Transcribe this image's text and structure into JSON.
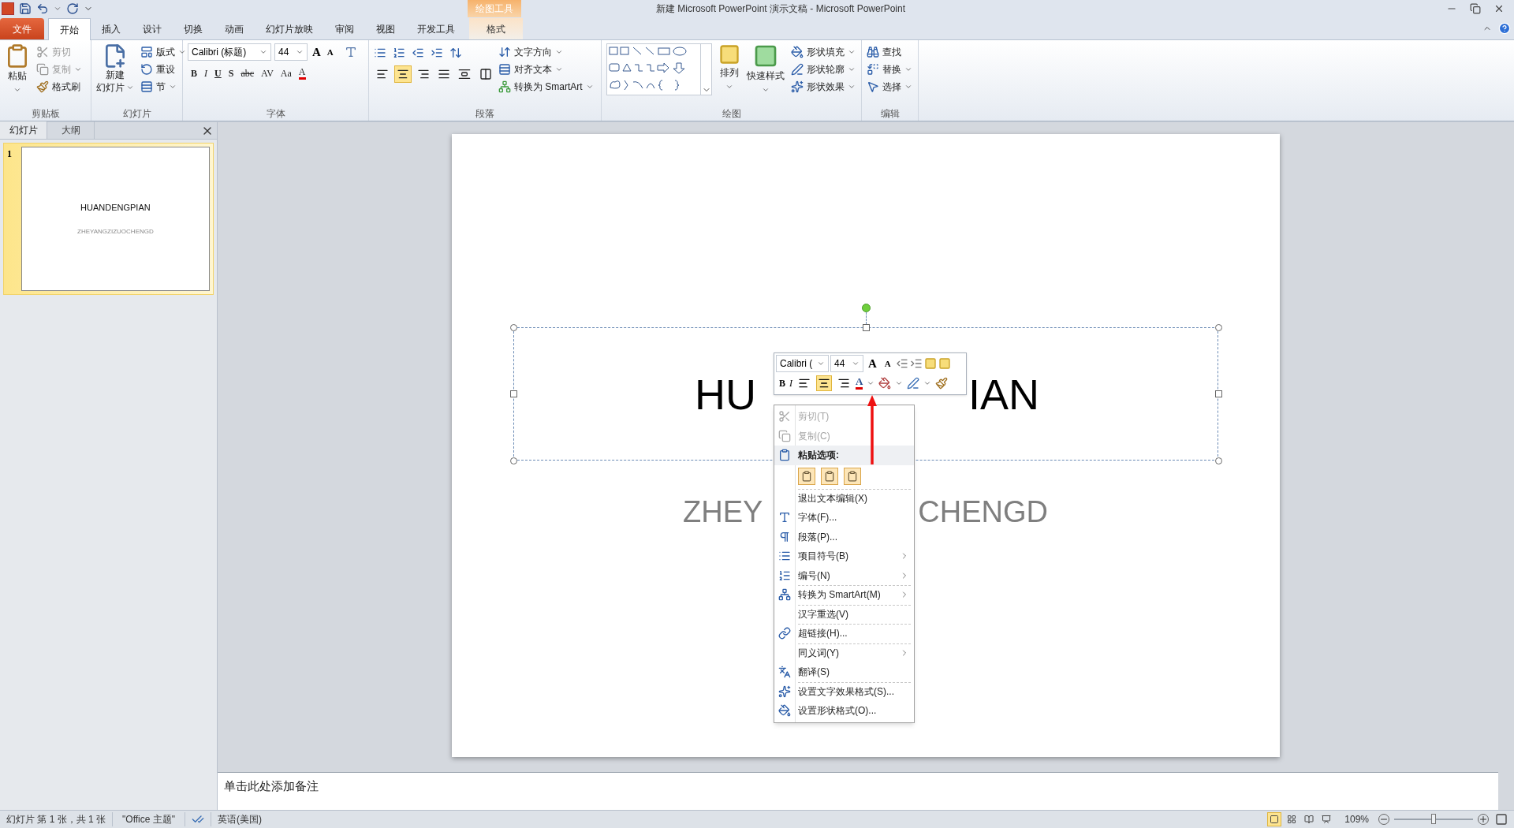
{
  "title_bar": {
    "title": "新建 Microsoft PowerPoint 演示文稿  -  Microsoft PowerPoint",
    "contextual_label": "绘图工具"
  },
  "ribbon_tabs": [
    {
      "label": "文件",
      "kind": "file",
      "selected": false
    },
    {
      "label": "开始",
      "kind": "tab",
      "selected": true
    },
    {
      "label": "插入",
      "kind": "tab",
      "selected": false
    },
    {
      "label": "设计",
      "kind": "tab",
      "selected": false
    },
    {
      "label": "切换",
      "kind": "tab",
      "selected": false
    },
    {
      "label": "动画",
      "kind": "tab",
      "selected": false
    },
    {
      "label": "幻灯片放映",
      "kind": "tab",
      "selected": false
    },
    {
      "label": "审阅",
      "kind": "tab",
      "selected": false
    },
    {
      "label": "视图",
      "kind": "tab",
      "selected": false
    },
    {
      "label": "开发工具",
      "kind": "tab",
      "selected": false
    },
    {
      "label": "格式",
      "kind": "contextual",
      "selected": false
    }
  ],
  "ribbon_groups": [
    {
      "kind": "clipboard",
      "label": "剪贴板",
      "paste": "粘贴",
      "commands": [
        {
          "label": "剪切",
          "disabled": true,
          "dropdown": false
        },
        {
          "label": "复制",
          "disabled": true,
          "dropdown": true
        },
        {
          "label": "格式刷",
          "disabled": false,
          "dropdown": false
        }
      ]
    },
    {
      "kind": "slides",
      "label": "幻灯片",
      "new_slide": [
        "新建",
        "幻灯片"
      ],
      "commands": [
        {
          "label": "版式",
          "dropdown": true
        },
        {
          "label": "重设",
          "dropdown": false
        },
        {
          "label": "节",
          "dropdown": true
        }
      ]
    },
    {
      "kind": "font",
      "label": "字体",
      "font_name": "Calibri (标题)",
      "font_size": "44",
      "grow": "A",
      "shrink": "A",
      "format_buttons": [
        {
          "label": "B",
          "kind": "bold"
        },
        {
          "label": "I",
          "kind": "italic"
        },
        {
          "label": "U",
          "kind": "underline"
        },
        {
          "label": "S",
          "kind": "shadow"
        },
        {
          "label": "abc",
          "kind": "strike"
        },
        {
          "label": "AV",
          "kind": "spacing"
        },
        {
          "label": "Aa",
          "kind": "case"
        },
        {
          "label": "A",
          "kind": "color"
        }
      ]
    },
    {
      "kind": "paragraph",
      "label": "段落",
      "align_buttons": [
        {
          "kind": "left",
          "selected": false
        },
        {
          "kind": "center",
          "selected": true
        },
        {
          "kind": "right",
          "selected": false
        },
        {
          "kind": "justify",
          "selected": false
        },
        {
          "kind": "distributed",
          "selected": false
        }
      ],
      "commands": [
        "文字方向",
        "对齐文本",
        "转换为 SmartArt"
      ]
    },
    {
      "kind": "drawing",
      "label": "绘图",
      "arrange": "排列",
      "quick_styles": "快速样式",
      "commands": [
        "形状填充",
        "形状轮廓",
        "形状效果"
      ]
    },
    {
      "kind": "editing",
      "label": "编辑",
      "commands": [
        {
          "label": "查找",
          "dropdown": false
        },
        {
          "label": "替换",
          "dropdown": true
        },
        {
          "label": "选择",
          "dropdown": true
        }
      ]
    }
  ],
  "slide_panel": {
    "tabs": [
      {
        "label": "幻灯片",
        "selected": true
      },
      {
        "label": "大纲",
        "selected": false
      }
    ],
    "thumbnails": [
      {
        "number": "1",
        "title": "HUANDENGPIAN",
        "subtitle": "ZHEYANGZIZUOCHENGD",
        "selected": true
      }
    ]
  },
  "slide": {
    "title_parts": [
      "HU",
      "IAN"
    ],
    "subtitle_parts": [
      "ZHEY",
      "CHENGD"
    ]
  },
  "mini_toolbar": {
    "font_name": "Calibri (",
    "font_size": "44",
    "grow": "A",
    "shrink": "A",
    "bold": "B",
    "italic": "I",
    "align_buttons": [
      {
        "kind": "left",
        "selected": false
      },
      {
        "kind": "center",
        "selected": true
      },
      {
        "kind": "right",
        "selected": false
      }
    ],
    "font_color_button": "A"
  },
  "context_menu": [
    {
      "kind": "item",
      "label": "剪切(T)",
      "disabled": true,
      "submenu": false,
      "separator_before": false
    },
    {
      "kind": "item",
      "label": "复制(C)",
      "disabled": true,
      "submenu": false,
      "separator_before": false
    },
    {
      "kind": "header",
      "label": "粘贴选项:",
      "disabled": false,
      "submenu": false,
      "separator_before": false
    },
    {
      "kind": "paste_options",
      "disabled": false,
      "submenu": false,
      "separator_before": false
    },
    {
      "kind": "item",
      "label": "退出文本编辑(X)",
      "disabled": false,
      "submenu": false,
      "separator_before": true
    },
    {
      "kind": "item",
      "label": "字体(F)...",
      "disabled": false,
      "submenu": false,
      "separator_before": false
    },
    {
      "kind": "item",
      "label": "段落(P)...",
      "disabled": false,
      "submenu": false,
      "separator_before": false
    },
    {
      "kind": "item",
      "label": "项目符号(B)",
      "disabled": false,
      "submenu": true,
      "separator_before": false
    },
    {
      "kind": "item",
      "label": "编号(N)",
      "disabled": false,
      "submenu": true,
      "separator_before": false
    },
    {
      "kind": "item",
      "label": "转换为 SmartArt(M)",
      "disabled": false,
      "submenu": true,
      "separator_before": true
    },
    {
      "kind": "item",
      "label": "汉字重选(V)",
      "disabled": false,
      "submenu": false,
      "separator_before": true
    },
    {
      "kind": "item",
      "label": "超链接(H)...",
      "disabled": false,
      "submenu": false,
      "separator_before": true
    },
    {
      "kind": "item",
      "label": "同义词(Y)",
      "disabled": false,
      "submenu": true,
      "separator_before": true
    },
    {
      "kind": "item",
      "label": "翻译(S)",
      "disabled": false,
      "submenu": false,
      "separator_before": false
    },
    {
      "kind": "item",
      "label": "设置文字效果格式(S)...",
      "disabled": false,
      "submenu": false,
      "separator_before": true
    },
    {
      "kind": "item",
      "label": "设置形状格式(O)...",
      "disabled": false,
      "submenu": false,
      "separator_before": false
    }
  ],
  "notes": {
    "placeholder": "单击此处添加备注"
  },
  "status_bar": {
    "slide_info": "幻灯片 第 1 张，共 1 张",
    "theme": "\"Office 主题\"",
    "language": "英语(美国)",
    "view_buttons": [
      {
        "kind": "normal",
        "selected": true
      },
      {
        "kind": "sorter",
        "selected": false
      },
      {
        "kind": "reading",
        "selected": false
      },
      {
        "kind": "slideshow",
        "selected": false
      }
    ],
    "zoom": {
      "reading": "109%",
      "level": 0.5
    }
  }
}
